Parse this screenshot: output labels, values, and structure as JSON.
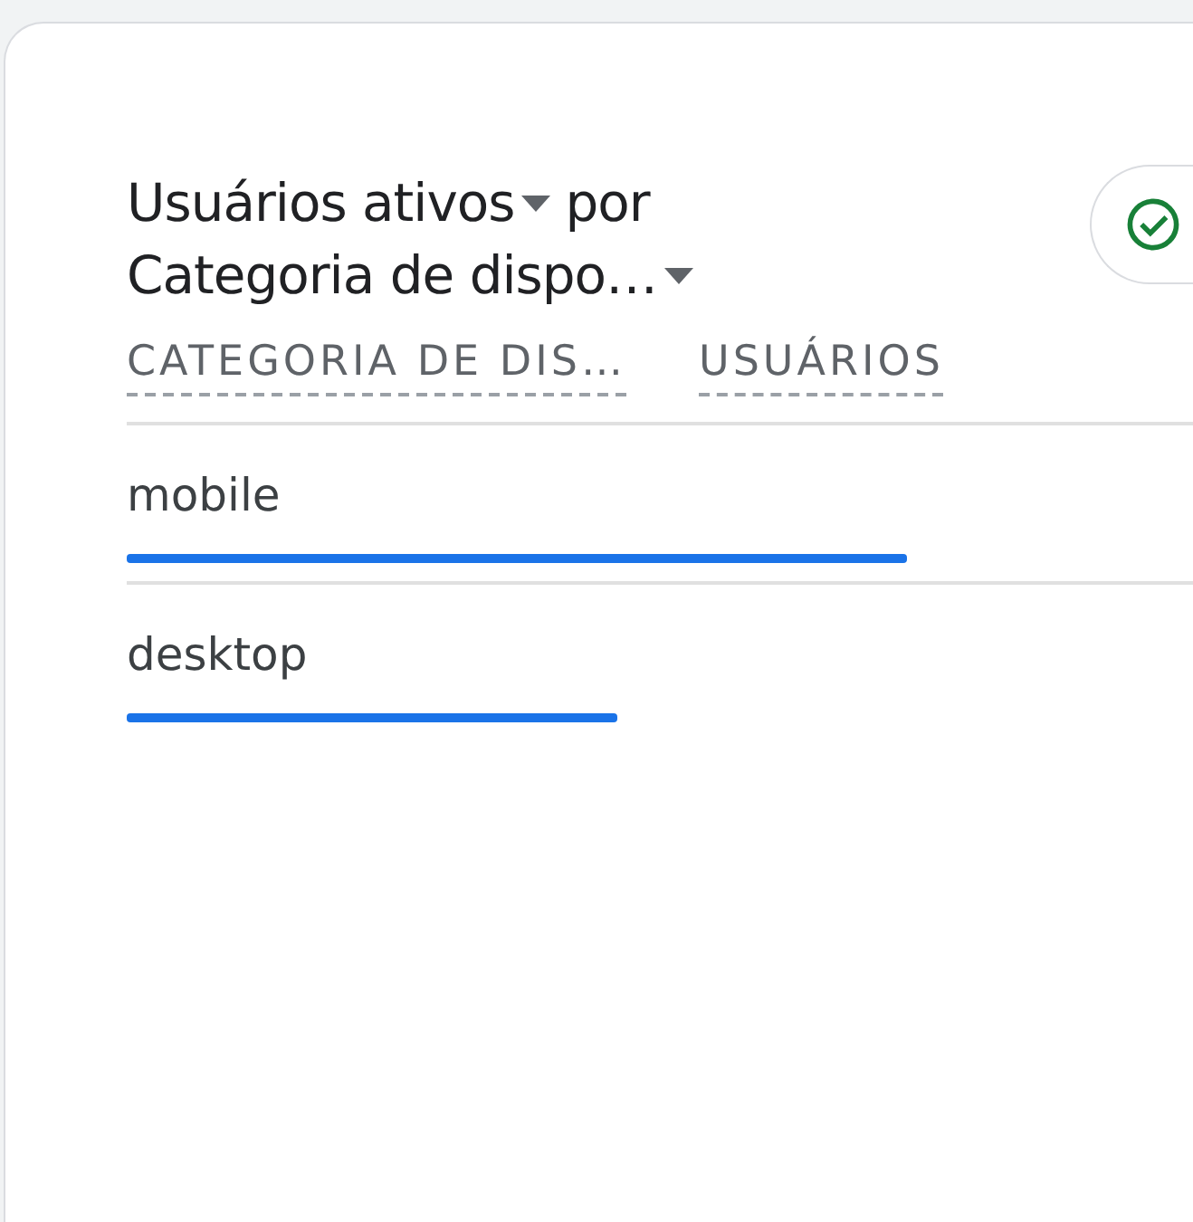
{
  "card": {
    "title": {
      "metric": "Usuários ativos",
      "connector": "por",
      "dimension": "Categoria de dispo…"
    },
    "table": {
      "columns": [
        "CATEGORIA DE DIS…",
        "USUÁRIOS"
      ],
      "rows": [
        {
          "label": "mobile",
          "level": 0.73
        },
        {
          "label": "desktop",
          "level": 0.46
        }
      ]
    }
  }
}
